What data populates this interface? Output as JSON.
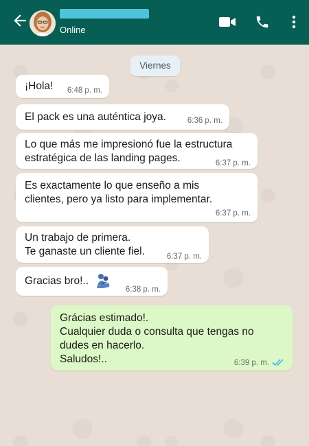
{
  "header": {
    "status": "Online",
    "name_redacted": true
  },
  "chat": {
    "date_label": "Viernes",
    "messages": [
      {
        "dir": "in",
        "text": "¡Hola!",
        "time": "6:48 p. m."
      },
      {
        "dir": "in",
        "text": "El pack es una auténtica joya.",
        "time": "6:36 p. m."
      },
      {
        "dir": "in",
        "text": "Lo que más me impresionó fue la estructura\nestratégica de las landing pages.",
        "time": "6:37 p. m."
      },
      {
        "dir": "in",
        "text": "Es exactamente lo que enseño a mis\nclientes, pero ya listo para implementar.",
        "time": "6:37 p. m."
      },
      {
        "dir": "in",
        "text": "Un trabajo de primera.\nTe ganaste un cliente fiel.",
        "time": "6:37 p. m."
      },
      {
        "dir": "in",
        "text": "Gracias bro!..",
        "time": "6:38 p. m.",
        "icon": "handshake-sticker-icon"
      },
      {
        "dir": "out",
        "text": "Grácias estimado!.\nCualquier duda o consulta que tengas no\ndudes en hacerlo.\nSaludos!..",
        "time": "6:39 p. m.",
        "read": true
      }
    ]
  },
  "colors": {
    "header": "#075e54",
    "incoming_bubble": "#ffffff",
    "outgoing_bubble": "#dcf8c6",
    "read_ticks": "#34b7f1",
    "wallpaper": "#e8ded5"
  }
}
